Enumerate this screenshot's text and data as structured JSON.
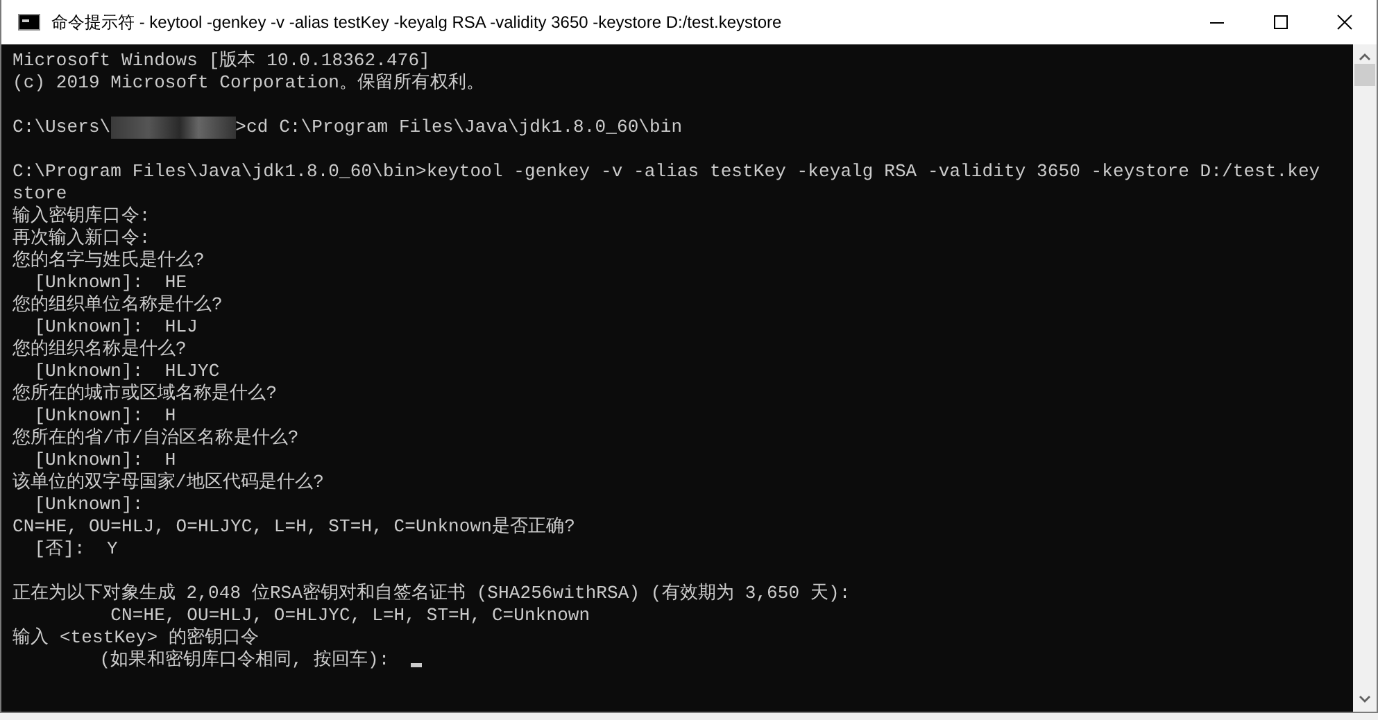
{
  "window": {
    "title": "命令提示符 - keytool  -genkey -v -alias testKey -keyalg RSA -validity 3650 -keystore D:/test.keystore"
  },
  "console": {
    "lines": [
      {
        "kind": "text",
        "text": "Microsoft Windows [版本 10.0.18362.476]"
      },
      {
        "kind": "text",
        "text": "(c) 2019 Microsoft Corporation。保留所有权利。"
      },
      {
        "kind": "blank"
      },
      {
        "kind": "masked",
        "before": "C:\\Users\\",
        "after": ">cd C:\\Program Files\\Java\\jdk1.8.0_60\\bin"
      },
      {
        "kind": "blank"
      },
      {
        "kind": "text",
        "text": "C:\\Program Files\\Java\\jdk1.8.0_60\\bin>keytool -genkey -v -alias testKey -keyalg RSA -validity 3650 -keystore D:/test.key"
      },
      {
        "kind": "text",
        "text": "store"
      },
      {
        "kind": "text",
        "text": "输入密钥库口令:"
      },
      {
        "kind": "text",
        "text": "再次输入新口令:"
      },
      {
        "kind": "text",
        "text": "您的名字与姓氏是什么?"
      },
      {
        "kind": "text",
        "text": "  [Unknown]:  HE"
      },
      {
        "kind": "text",
        "text": "您的组织单位名称是什么?"
      },
      {
        "kind": "text",
        "text": "  [Unknown]:  HLJ"
      },
      {
        "kind": "text",
        "text": "您的组织名称是什么?"
      },
      {
        "kind": "text",
        "text": "  [Unknown]:  HLJYC"
      },
      {
        "kind": "text",
        "text": "您所在的城市或区域名称是什么?"
      },
      {
        "kind": "text",
        "text": "  [Unknown]:  H"
      },
      {
        "kind": "text",
        "text": "您所在的省/市/自治区名称是什么?"
      },
      {
        "kind": "text",
        "text": "  [Unknown]:  H"
      },
      {
        "kind": "text",
        "text": "该单位的双字母国家/地区代码是什么?"
      },
      {
        "kind": "text",
        "text": "  [Unknown]:"
      },
      {
        "kind": "text",
        "text": "CN=HE, OU=HLJ, O=HLJYC, L=H, ST=H, C=Unknown是否正确?"
      },
      {
        "kind": "text",
        "text": "  [否]:  Y"
      },
      {
        "kind": "blank"
      },
      {
        "kind": "text",
        "text": "正在为以下对象生成 2,048 位RSA密钥对和自签名证书 (SHA256withRSA) (有效期为 3,650 天):"
      },
      {
        "kind": "text",
        "text": "         CN=HE, OU=HLJ, O=HLJYC, L=H, ST=H, C=Unknown"
      },
      {
        "kind": "text",
        "text": "输入 <testKey> 的密钥口令"
      },
      {
        "kind": "cursor",
        "text": "        (如果和密钥库口令相同, 按回车):  "
      }
    ]
  }
}
